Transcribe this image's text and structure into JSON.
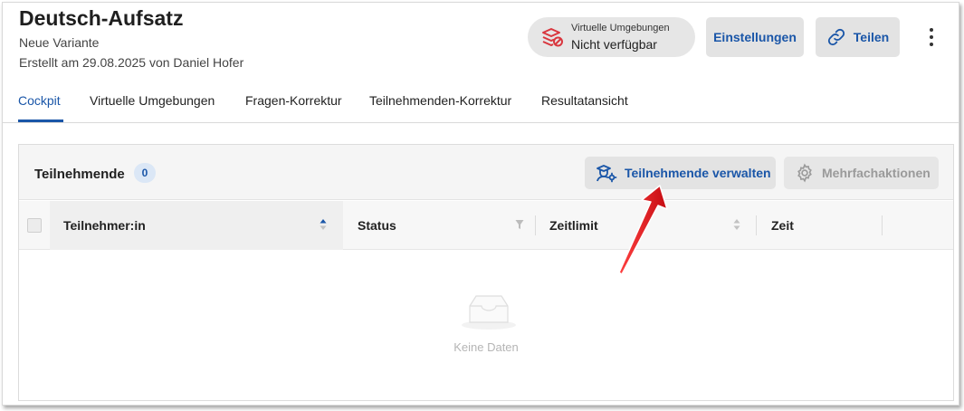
{
  "header": {
    "title": "Deutsch-Aufsatz",
    "subtitle": "Neue Variante",
    "created": "Erstellt am 29.08.2025 von Daniel Hofer"
  },
  "venv_status": {
    "label": "Virtuelle Umgebungen",
    "value": "Nicht verfügbar",
    "icon": "virtual-env-blocked-icon",
    "icon_color": "#d9363e"
  },
  "actions": {
    "settings_label": "Einstellungen",
    "share_label": "Teilen",
    "share_icon": "link-icon",
    "more_icon": "more-vertical-icon"
  },
  "tabs": [
    {
      "label": "Cockpit",
      "active": true
    },
    {
      "label": "Virtuelle Umgebungen",
      "active": false
    },
    {
      "label": "Fragen-Korrektur",
      "active": false
    },
    {
      "label": "Teilnehmenden-Korrektur",
      "active": false
    },
    {
      "label": "Resultatansicht",
      "active": false
    }
  ],
  "panel": {
    "title": "Teilnehmende",
    "count": "0",
    "manage_label": "Teilnehmende verwalten",
    "manage_icon": "participants-settings-icon",
    "bulk_label": "Mehrfachaktionen",
    "bulk_icon": "gear-icon",
    "bulk_disabled": true
  },
  "table": {
    "columns": [
      {
        "label": "Teilnehmer:in",
        "indicator": "sort-asc",
        "indicator_color": "#1a56a8"
      },
      {
        "label": "Status",
        "indicator": "filter"
      },
      {
        "label": "Zeitlimit",
        "indicator": "sort"
      },
      {
        "label": "Zeit",
        "indicator": "none"
      }
    ],
    "rows": [],
    "empty_text": "Keine Daten"
  },
  "annotation": {
    "arrow_color": "#e0141c",
    "arrow_points_to": "manage-participants-button"
  },
  "colors": {
    "accent": "#1a56a8",
    "button_bg": "#e3e3e3",
    "badge_bg": "#dbe7f6"
  }
}
